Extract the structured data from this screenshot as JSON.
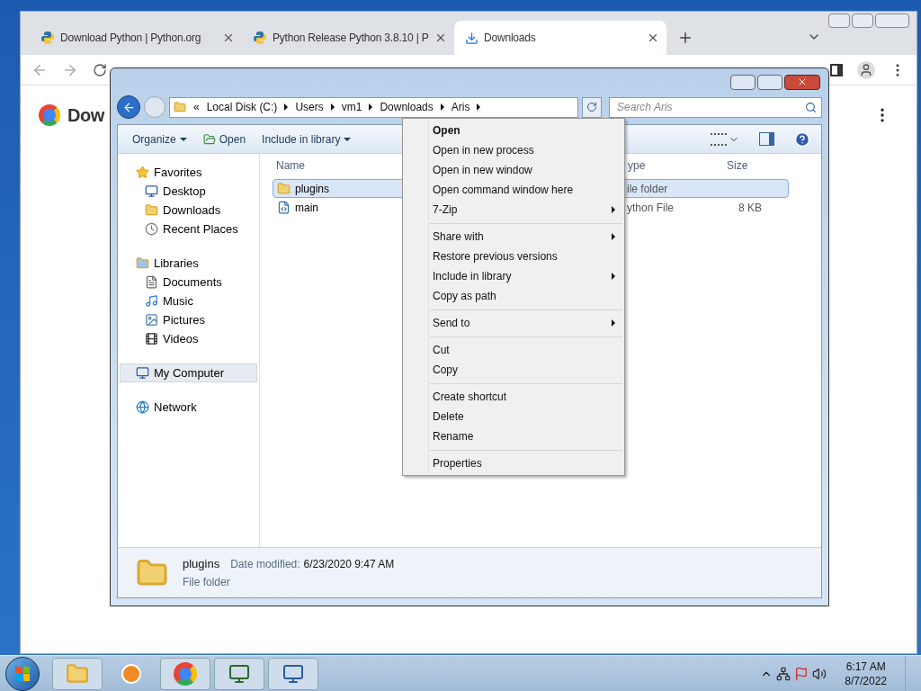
{
  "browser": {
    "tabs": [
      {
        "title": "Download Python | Python.org",
        "selected": false
      },
      {
        "title": "Python Release Python 3.8.10 | P",
        "selected": false
      },
      {
        "title": "Downloads",
        "selected": true
      }
    ],
    "page_heading": "Dow"
  },
  "explorer": {
    "breadcrumb": [
      "«",
      "Local Disk (C:)",
      "Users",
      "vm1",
      "Downloads",
      "Aris"
    ],
    "search": {
      "placeholder": "Search Aris"
    },
    "toolbar": [
      {
        "label": "Organize",
        "dropdown": true
      },
      {
        "label": "Open",
        "dropdown": false
      },
      {
        "label": "Include in library",
        "dropdown": true
      }
    ],
    "sidebar": [
      {
        "label": "Favorites",
        "selected": false,
        "children": [
          {
            "label": "Desktop",
            "selected": false
          },
          {
            "label": "Downloads",
            "selected": false
          },
          {
            "label": "Recent Places",
            "selected": false
          }
        ]
      },
      {
        "label": "Libraries",
        "selected": false,
        "children": [
          {
            "label": "Documents",
            "selected": false
          },
          {
            "label": "Music",
            "selected": false
          },
          {
            "label": "Pictures",
            "selected": false
          },
          {
            "label": "Videos",
            "selected": false
          }
        ]
      },
      {
        "label": "My Computer",
        "selected": true
      },
      {
        "label": "Network",
        "selected": false
      }
    ],
    "columns": [
      "Name",
      "ype",
      "Size"
    ],
    "rows": [
      {
        "name": "plugins",
        "type": "ile folder",
        "kind": "folder",
        "selected": true
      },
      {
        "name": "main",
        "type": "ython File",
        "size": "8 KB",
        "kind": "script",
        "selected": false
      }
    ],
    "details": {
      "name": "plugins",
      "label": "Date modified:",
      "value": "6/23/2020 9:47 AM",
      "type": "File folder"
    }
  },
  "context_menu": [
    {
      "kind": "item",
      "label": "Open",
      "bold": true,
      "submenu": false
    },
    {
      "kind": "item",
      "label": "Open in new process",
      "bold": false,
      "submenu": false
    },
    {
      "kind": "item",
      "label": "Open in new window",
      "bold": false,
      "submenu": false
    },
    {
      "kind": "item",
      "label": "Open command window here",
      "bold": false,
      "submenu": false
    },
    {
      "kind": "item",
      "label": "7-Zip",
      "bold": false,
      "submenu": true
    },
    {
      "kind": "separator"
    },
    {
      "kind": "item",
      "label": "Share with",
      "bold": false,
      "submenu": true
    },
    {
      "kind": "item",
      "label": "Restore previous versions",
      "bold": false,
      "submenu": false
    },
    {
      "kind": "item",
      "label": "Include in library",
      "bold": false,
      "submenu": true
    },
    {
      "kind": "item",
      "label": "Copy as path",
      "bold": false,
      "submenu": false
    },
    {
      "kind": "separator"
    },
    {
      "kind": "item",
      "label": "Send to",
      "bold": false,
      "submenu": true
    },
    {
      "kind": "separator"
    },
    {
      "kind": "item",
      "label": "Cut",
      "bold": false,
      "submenu": false
    },
    {
      "kind": "item",
      "label": "Copy",
      "bold": false,
      "submenu": false
    },
    {
      "kind": "separator"
    },
    {
      "kind": "item",
      "label": "Create shortcut",
      "bold": false,
      "submenu": false
    },
    {
      "kind": "item",
      "label": "Delete",
      "bold": false,
      "submenu": false
    },
    {
      "kind": "item",
      "label": "Rename",
      "bold": false,
      "submenu": false
    },
    {
      "kind": "separator"
    },
    {
      "kind": "item",
      "label": "Properties",
      "bold": false,
      "submenu": false
    }
  ],
  "taskbar": {
    "time": "6:17 AM",
    "date": "8/7/2022"
  }
}
